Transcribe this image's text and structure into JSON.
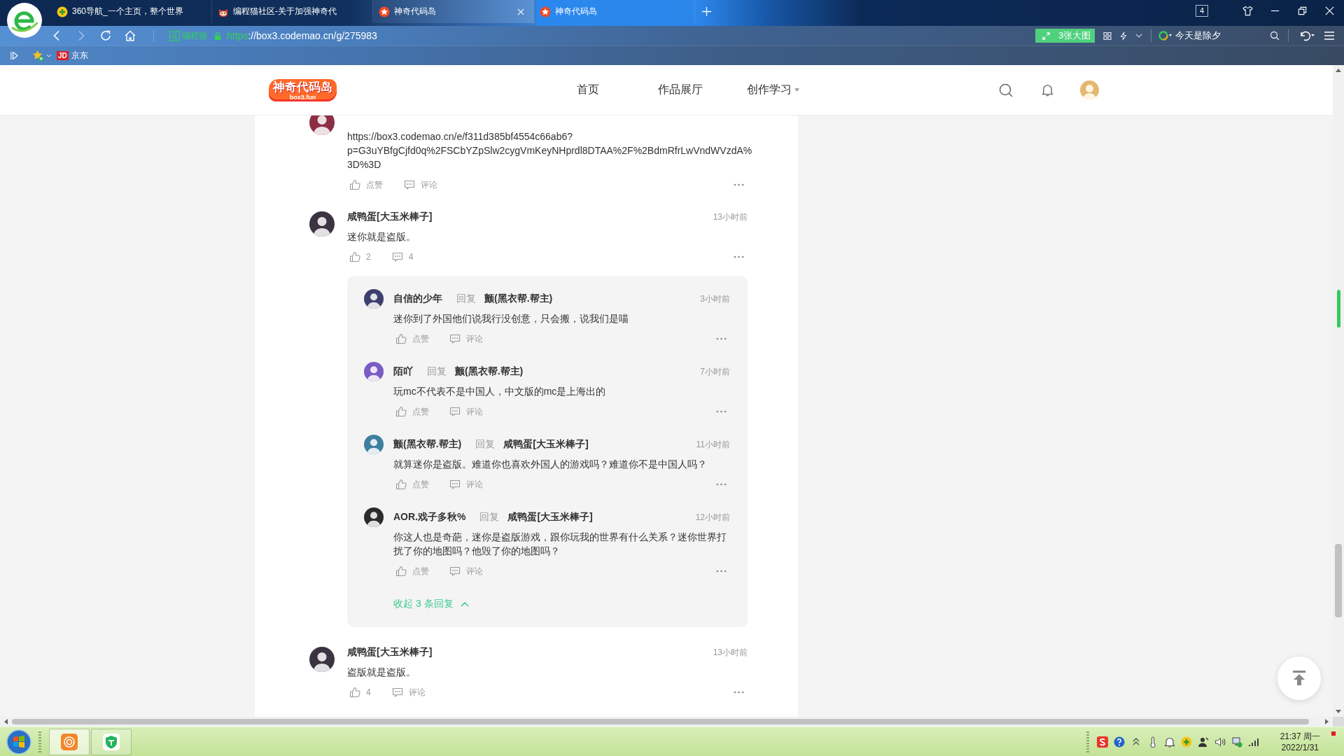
{
  "browser": {
    "tabs": [
      {
        "title": "360导航_一个主页，整个世界",
        "kind": "nav",
        "selected": false
      },
      {
        "title": "编程猫社区-关于加强神奇代",
        "kind": "forum",
        "selected": false
      },
      {
        "title": "神奇代码岛",
        "kind": "island",
        "selected": true
      },
      {
        "title": "神奇代码岛",
        "kind": "island",
        "selected": false
      }
    ],
    "tab_count": "4",
    "forward_enabled": false,
    "address": {
      "cert_mark": "证",
      "cert_name": "编程猫",
      "url_scheme": "https",
      "url_rest": "://box3.codemao.cn/g/275983"
    },
    "image_button": "3张大图",
    "news": "今天是除夕",
    "bookmarks": [
      {
        "logo": "JD",
        "label": "京东"
      }
    ]
  },
  "site": {
    "logo": {
      "title": "神奇代码岛",
      "subtitle": "box3.fun"
    },
    "nav": [
      {
        "label": "首页",
        "selected": false,
        "dropdown": false
      },
      {
        "label": "作品展厅",
        "selected": false,
        "dropdown": false
      },
      {
        "label": "创作学习",
        "selected": false,
        "dropdown": true
      }
    ]
  },
  "comments": [
    {
      "color": "#8c2f45",
      "text": "https://box3.codemao.cn/e/f311d385bf4554c66ab6?p=G3uYBfgCjfd0q%2FSCbYZpSlw2cygVmKeyNHprdl8DTAA%2F%2BdmRfrLwVndWVzdA%3D%3D",
      "likes": "点赞",
      "comment_count": "评论"
    },
    {
      "name": "咸鸭蛋[大玉米棒子]",
      "time": "13小时前",
      "color": "#3b3440",
      "text": "迷你就是盗版。",
      "likes": "2",
      "comment_count": "4",
      "replies": [
        {
          "name": "自信的少年",
          "reply_word": "回复",
          "target": "颤(黑衣帮.帮主)",
          "time": "3小时前",
          "color": "#3d3f6e",
          "text": "迷你到了外国他们说我行没创意，只会搬，说我们是喵",
          "likes": "点赞",
          "comment_count": "评论"
        },
        {
          "name": "陌吖",
          "reply_word": "回复",
          "target": "颤(黑衣帮.帮主)",
          "time": "7小时前",
          "color": "#7b5cc4",
          "text": "玩mc不代表不是中国人，中文版的mc是上海出的",
          "likes": "点赞",
          "comment_count": "评论"
        },
        {
          "name": "颤(黑衣帮.帮主)",
          "reply_word": "回复",
          "target": "咸鸭蛋[大玉米棒子]",
          "time": "11小时前",
          "color": "#3f7fa0",
          "text": "就算迷你是盗版。难道你也喜欢外国人的游戏吗？难道你不是中国人吗？",
          "likes": "点赞",
          "comment_count": "评论"
        },
        {
          "name": "AOR.戏子多秋%",
          "reply_word": "回复",
          "target": "咸鸭蛋[大玉米棒子]",
          "time": "12小时前",
          "color": "#2b2b2b",
          "text": "你这人也是奇葩，迷你是盗版游戏，跟你玩我的世界有什么关系？迷你世界打扰了你的地图吗？他毁了你的地图吗？",
          "likes": "点赞",
          "comment_count": "评论"
        }
      ],
      "collapse": "收起 3 条回复"
    },
    {
      "name": "咸鸭蛋[大玉米棒子]",
      "time": "13小时前",
      "color": "#3b3440",
      "text": "盗版就是盗版。",
      "likes": "4",
      "comment_count": "评论"
    }
  ],
  "taskbar": {
    "time": "21:37 周一",
    "date": "2022/1/31"
  }
}
